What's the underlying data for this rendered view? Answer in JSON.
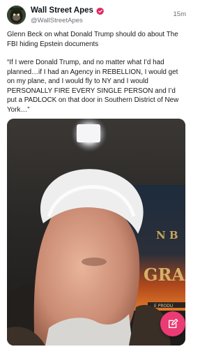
{
  "post": {
    "author_name": "Wall Street Apes",
    "author_handle": "@WallStreetApes",
    "timestamp": "15m",
    "verified": true,
    "paragraphs": [
      "Glenn Beck on what Donald Trump should do about The FBI hiding Epstein documents",
      "“If I were Donald Trump, and no matter what I’d had planned…if I had an Agency in REBELLION, I would get on my plane, and I would fly to NY and I would PERSONALLY FIRE EVERY SINGLE PERSON and I’d put a PADLOCK on that door in Southern District of New York…”"
    ]
  },
  "colors": {
    "verified_badge": "#e0245e",
    "fab": "#ea3b75",
    "handle_gray": "#6b6f75"
  },
  "icons": {
    "verified": "verified-badge-icon",
    "compose": "compose-icon"
  }
}
